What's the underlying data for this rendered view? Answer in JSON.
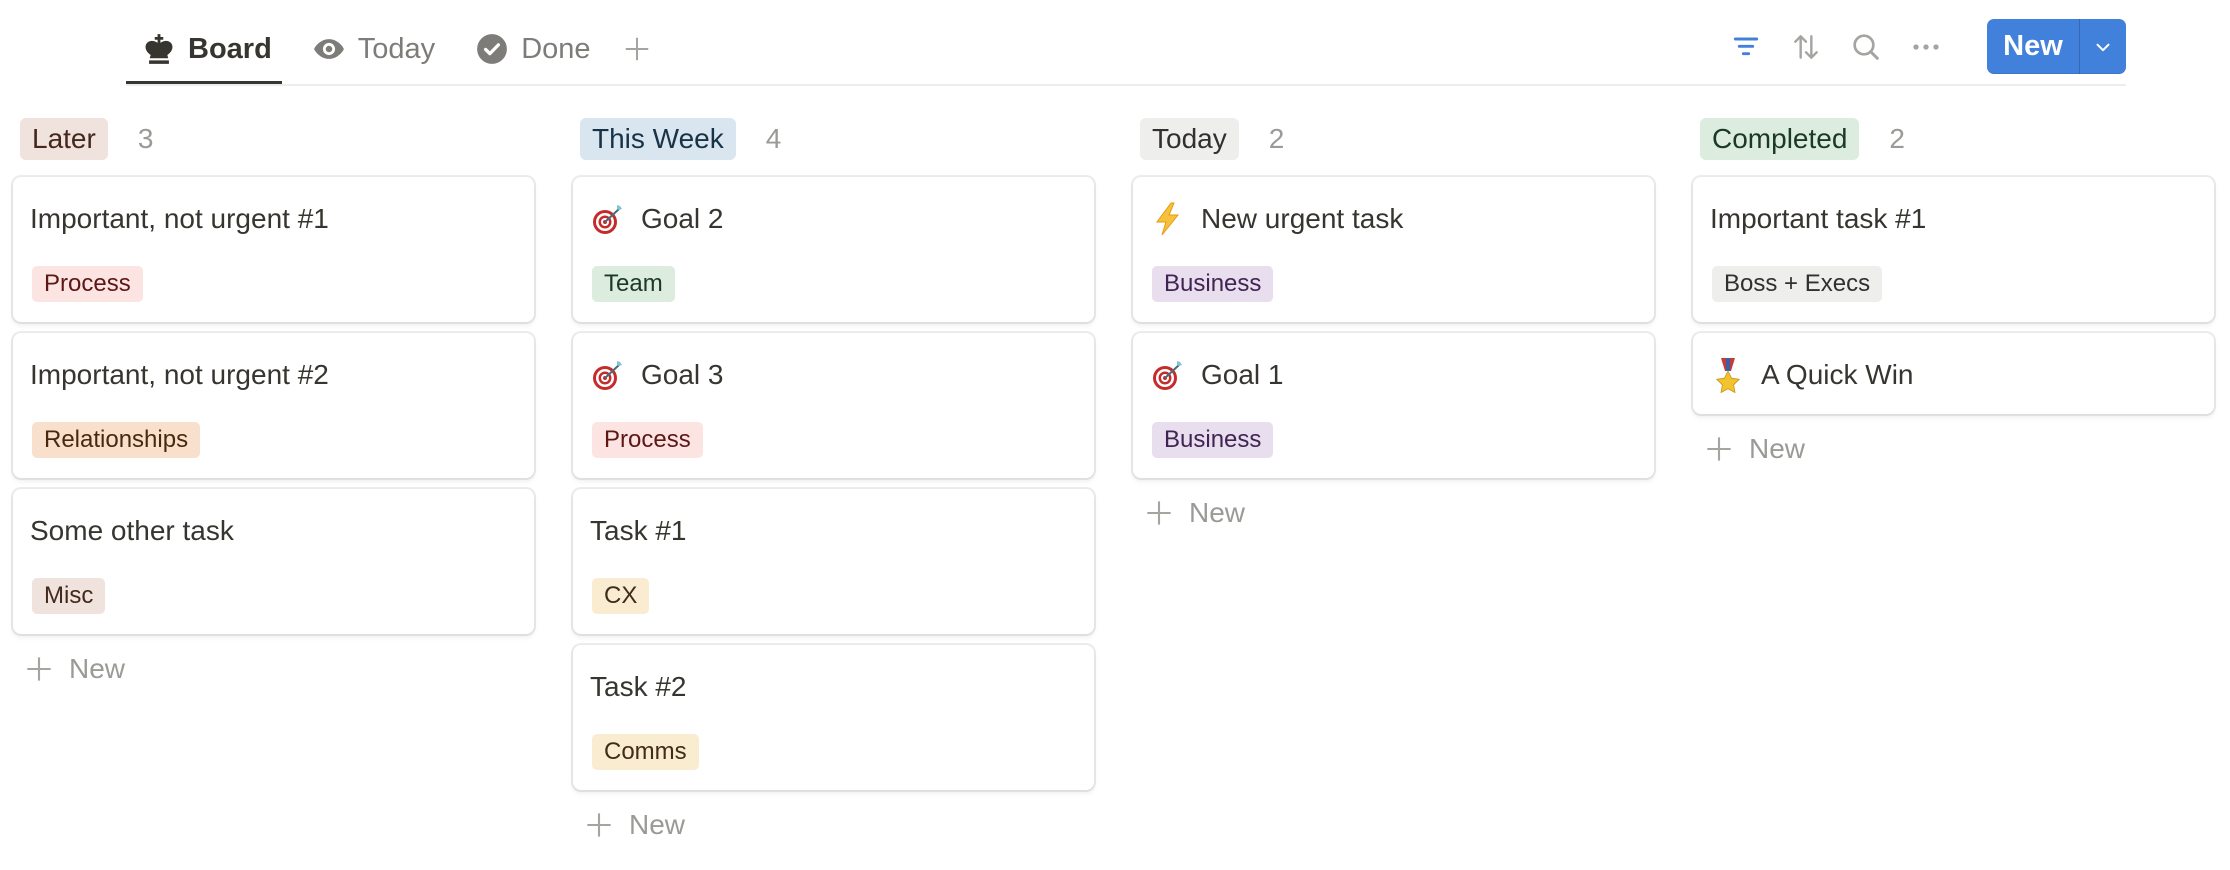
{
  "view_tabs": [
    {
      "label": "Board",
      "icon": "chess-king-icon",
      "active": true
    },
    {
      "label": "Today",
      "icon": "eye-icon",
      "active": false
    },
    {
      "label": "Done",
      "icon": "check-circle-icon",
      "active": false
    }
  ],
  "toolbar": {
    "add_view_icon": "plus-icon",
    "filter_icon": "filter-icon",
    "sort_icon": "sort-icon",
    "search_icon": "search-icon",
    "more_icon": "more-horizontal-icon",
    "new_label": "New",
    "new_dropdown_icon": "chevron-down-icon",
    "accent_color": "#4281db",
    "filter_active_color": "#4281db"
  },
  "board": {
    "add_label": "New",
    "columns": [
      {
        "title": "Later",
        "count": "3",
        "color": {
          "bg": "#f0e2dd",
          "fg": "#44281c"
        },
        "cards": [
          {
            "title": "Important, not urgent #1",
            "icon": null,
            "tag": {
              "label": "Process",
              "bg": "#fbe4e1",
              "fg": "#5d1715"
            }
          },
          {
            "title": "Important, not urgent #2",
            "icon": null,
            "tag": {
              "label": "Relationships",
              "bg": "#f8e0cd",
              "fg": "#49290e"
            }
          },
          {
            "title": "Some other task",
            "icon": null,
            "tag": {
              "label": "Misc",
              "bg": "#f0e2dd",
              "fg": "#44281c"
            }
          }
        ]
      },
      {
        "title": "This Week",
        "count": "4",
        "color": {
          "bg": "#d9e6f0",
          "fg": "#183347"
        },
        "cards": [
          {
            "title": "Goal 2",
            "icon": "dart-target-icon",
            "tag": {
              "label": "Team",
              "bg": "#dcecdf",
              "fg": "#1c3829"
            }
          },
          {
            "title": "Goal 3",
            "icon": "dart-target-icon",
            "tag": {
              "label": "Process",
              "bg": "#fbe4e1",
              "fg": "#5d1715"
            }
          },
          {
            "title": "Task #1",
            "icon": null,
            "tag": {
              "label": "CX",
              "bg": "#f9ecd0",
              "fg": "#402c1b"
            }
          },
          {
            "title": "Task #2",
            "icon": null,
            "tag": {
              "label": "Comms",
              "bg": "#f9ecd0",
              "fg": "#402c1b"
            }
          }
        ]
      },
      {
        "title": "Today",
        "count": "2",
        "color": {
          "bg": "#eeeeed",
          "fg": "#32302c"
        },
        "cards": [
          {
            "title": "New urgent task",
            "icon": "lightning-icon",
            "tag": {
              "label": "Business",
              "bg": "#e8deee",
              "fg": "#412454"
            }
          },
          {
            "title": "Goal 1",
            "icon": "dart-target-icon",
            "tag": {
              "label": "Business",
              "bg": "#e8deee",
              "fg": "#412454"
            }
          }
        ]
      },
      {
        "title": "Completed",
        "count": "2",
        "color": {
          "bg": "#dcecdf",
          "fg": "#1c3829"
        },
        "cards": [
          {
            "title": "Important task #1",
            "icon": null,
            "tag": {
              "label": "Boss + Execs",
              "bg": "#eeeeed",
              "fg": "#32302c"
            }
          },
          {
            "title": "A Quick Win",
            "icon": "military-medal-icon",
            "tag": null
          }
        ]
      }
    ]
  }
}
